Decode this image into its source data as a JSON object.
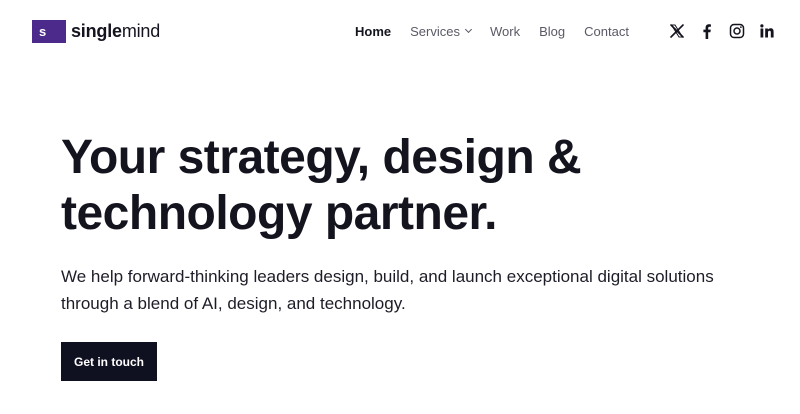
{
  "brand": {
    "mark": "s",
    "name_bold": "single",
    "name_light": "mind",
    "color": "#4b2a8c"
  },
  "nav": {
    "items": [
      {
        "label": "Home",
        "active": true
      },
      {
        "label": "Services",
        "has_dropdown": true
      },
      {
        "label": "Work"
      },
      {
        "label": "Blog"
      },
      {
        "label": "Contact"
      }
    ]
  },
  "social": [
    {
      "icon": "x-icon"
    },
    {
      "icon": "facebook-icon"
    },
    {
      "icon": "instagram-icon"
    },
    {
      "icon": "linkedin-icon"
    }
  ],
  "hero": {
    "title_line1": "Your strategy, design &",
    "title_line2": "technology partner.",
    "subtitle_line1": "We help forward-thinking leaders design, build, and launch exceptional digital solutions",
    "subtitle_line2": "through a blend of AI, design, and technology.",
    "cta_label": "Get in touch",
    "cta_color": "#0f1020"
  }
}
